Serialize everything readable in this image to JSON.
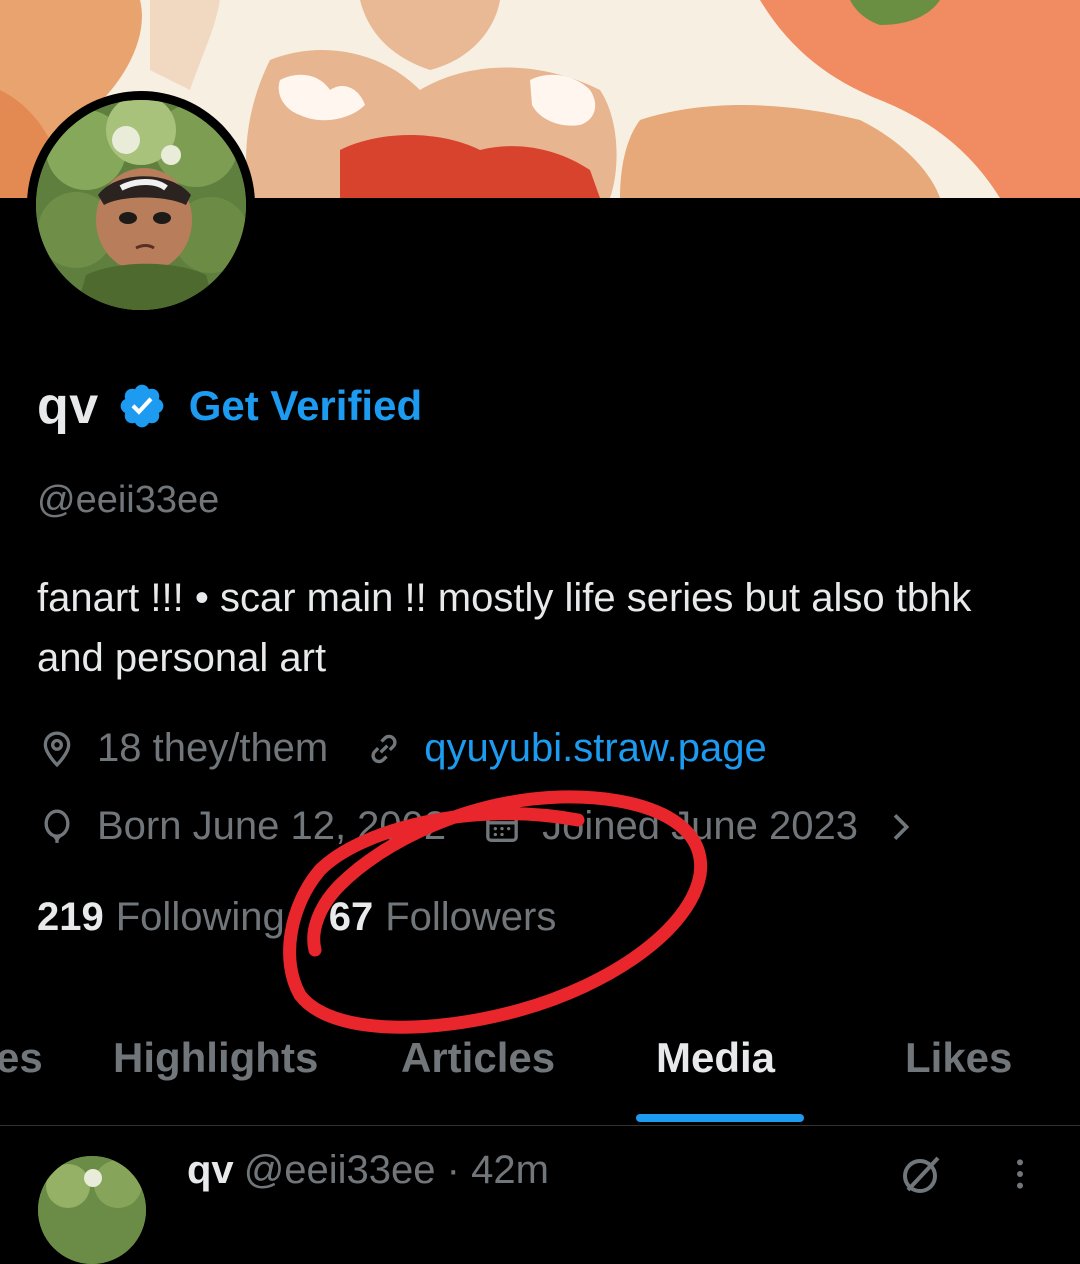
{
  "profile": {
    "display_name": "qv",
    "get_verified_label": "Get Verified",
    "handle": "@eeii33ee",
    "bio": "fanart !!! • scar main !!  mostly life series but also tbhk and personal art",
    "location": "18 they/them",
    "website": "qyuyubi.straw.page",
    "birthday": "Born June 12, 2002",
    "joined": "Joined June 2023",
    "following_count": "219",
    "following_label": "Following",
    "followers_count": "67",
    "followers_label": "Followers"
  },
  "tabs": [
    {
      "label": "es"
    },
    {
      "label": "Highlights"
    },
    {
      "label": "Articles"
    },
    {
      "label": "Media",
      "active": true
    },
    {
      "label": "Likes"
    }
  ],
  "post_preview": {
    "name": "qv",
    "handle": "@eeii33ee",
    "separator": "·",
    "time": "42m"
  },
  "icons": {
    "verified": "verified-badge-icon",
    "location": "location-pin-icon",
    "link": "link-icon",
    "birthday": "balloon-icon",
    "joined": "calendar-icon",
    "expand": "chevron-right-icon",
    "grok": "grok-icon",
    "more": "more-vertical-icon"
  },
  "colors": {
    "accent": "#1d9bf0",
    "background": "#000000",
    "text_primary": "#e7e9ea",
    "text_secondary": "#71767b",
    "annotation": "#e8262c"
  }
}
